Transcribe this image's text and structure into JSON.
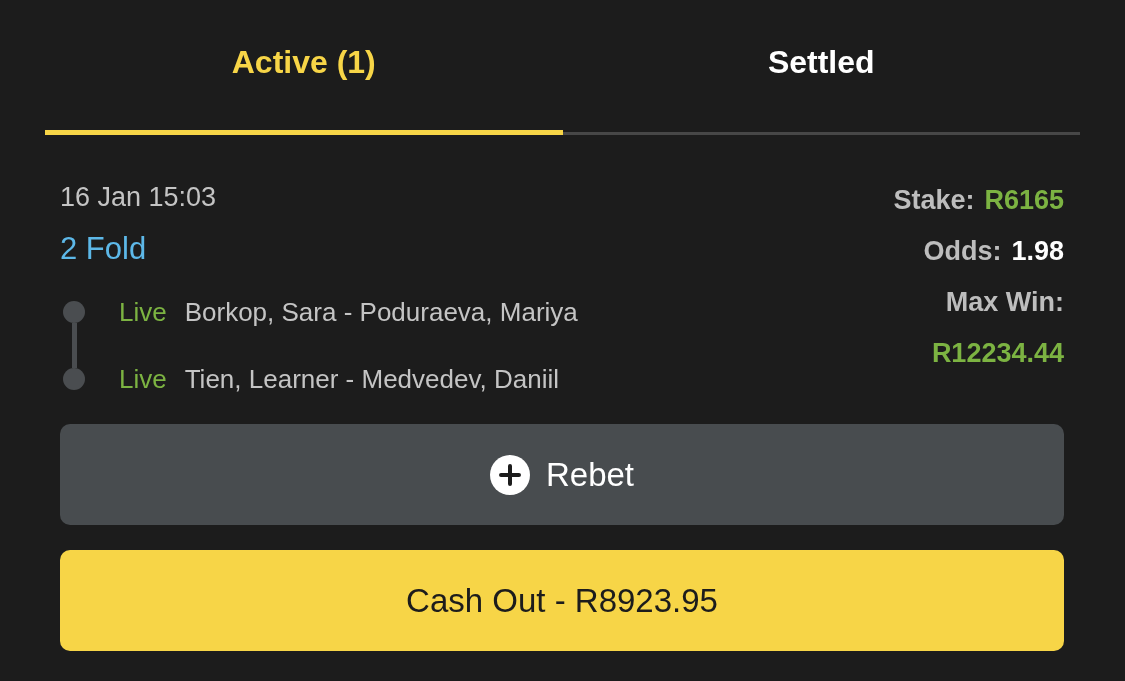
{
  "tabs": [
    {
      "label": "Active (1)",
      "selected": true
    },
    {
      "label": "Settled",
      "selected": false
    }
  ],
  "bet": {
    "placed": "16 Jan 15:03",
    "type": "2 Fold",
    "legs": [
      {
        "status": "Live",
        "match": "Borkop, Sara - Poduraeva, Mariya"
      },
      {
        "status": "Live",
        "match": "Tien, Learner - Medvedev, Daniil"
      }
    ],
    "stake": {
      "label": "Stake:",
      "value": "R6165"
    },
    "odds": {
      "label": "Odds:",
      "value": "1.98"
    },
    "max_win": {
      "label": "Max Win:",
      "value": "R12234.44"
    }
  },
  "buttons": {
    "rebet": "Rebet",
    "cash_out": "Cash Out - R8923.95"
  }
}
